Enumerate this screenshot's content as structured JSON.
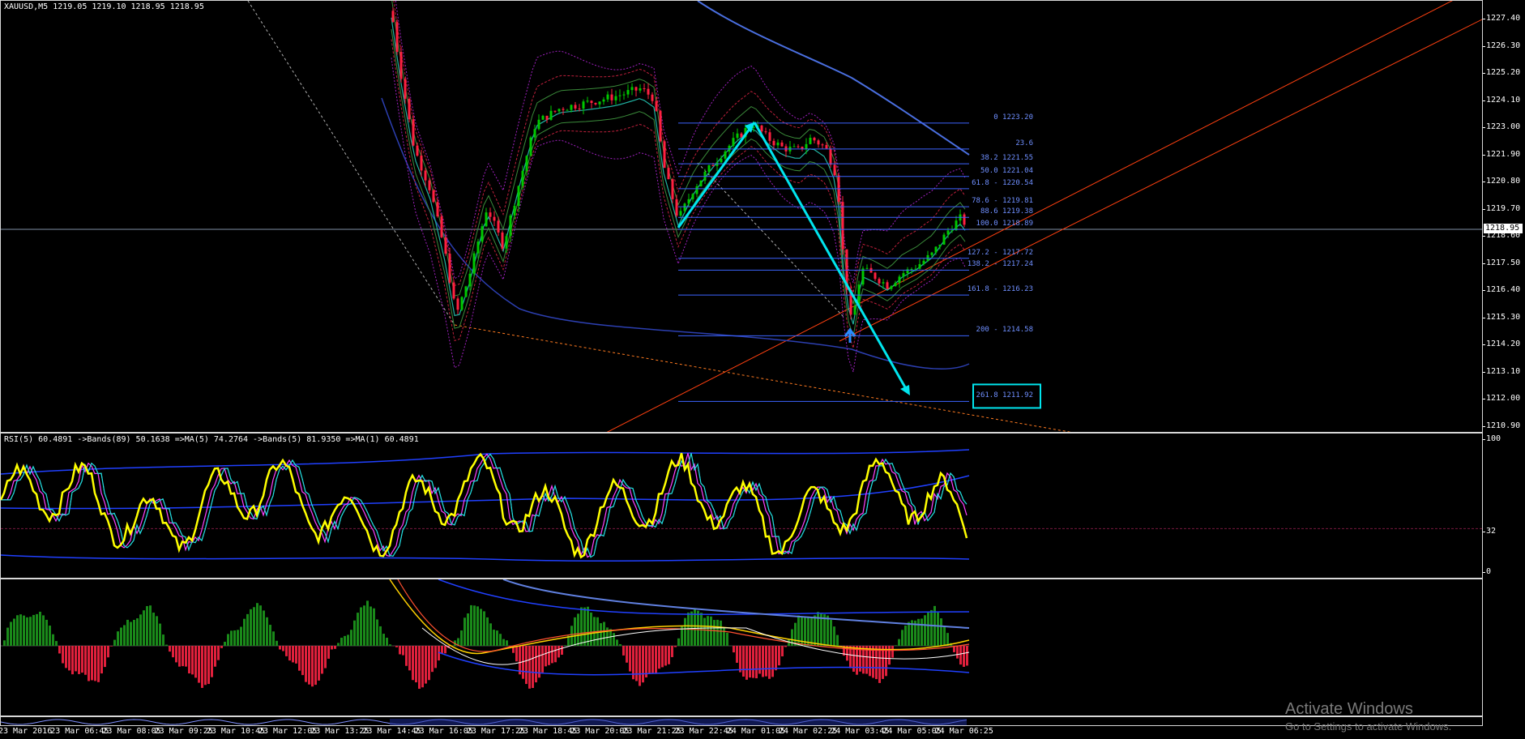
{
  "window": {
    "main_title": "XAUUSD,M5  1219.05 1219.10 1218.95 1218.95",
    "rsi_title": "RSI(5) 60.4891  ->Bands(89) 50.1638  =>MA(5) 74.2764  ->Bands(5) 81.9350  =>MA(1) 60.4891",
    "current_price": "1218.95"
  },
  "price_axis": [
    "1227.40",
    "1226.30",
    "1225.20",
    "1224.10",
    "1223.00",
    "1221.90",
    "1220.80",
    "1219.70",
    "1218.60",
    "1217.50",
    "1216.40",
    "1215.30",
    "1214.20",
    "1213.10",
    "1212.00",
    "1210.90"
  ],
  "rsi_axis": [
    "100",
    "32",
    "0"
  ],
  "fib_levels": [
    {
      "label": "0 1223.20",
      "price": 1223.2
    },
    {
      "label": "23.6",
      "price": 1222.15
    },
    {
      "label": "38.2 1221.55",
      "price": 1221.55
    },
    {
      "label": "50.0 1221.04",
      "price": 1221.04
    },
    {
      "label": "61.8 - 1220.54",
      "price": 1220.54
    },
    {
      "label": "78.6 - 1219.81",
      "price": 1219.81
    },
    {
      "label": "88.6 1219.38",
      "price": 1219.38
    },
    {
      "label": "100.0 1218.89",
      "price": 1218.89
    },
    {
      "label": "127.2 - 1217.72",
      "price": 1217.72
    },
    {
      "label": "138.2 - 1217.24",
      "price": 1217.24
    },
    {
      "label": "161.8 - 1216.23",
      "price": 1216.23
    },
    {
      "label": "200 - 1214.58",
      "price": 1214.58
    },
    {
      "label": "261.8 1211.92",
      "price": 1211.92
    }
  ],
  "time_axis": [
    "23 Mar 2016",
    "23 Mar 06:45",
    "23 Mar 08:05",
    "23 Mar 09:25",
    "23 Mar 10:45",
    "23 Mar 12:05",
    "23 Mar 13:25",
    "23 Mar 14:45",
    "23 Mar 16:05",
    "23 Mar 17:25",
    "23 Mar 18:45",
    "23 Mar 20:05",
    "23 Mar 21:25",
    "23 Mar 22:45",
    "24 Mar 01:05",
    "24 Mar 02:25",
    "24 Mar 03:45",
    "24 Mar 05:05",
    "24 Mar 06:25"
  ],
  "watermark": {
    "line1": "Activate Windows",
    "line2": "Go to Settings to activate Windows."
  },
  "colors": {
    "bull": "#00c800",
    "bear": "#ff2040",
    "fib": "#3c64ff",
    "cyan": "#00e5ee",
    "trend": "#ff4010",
    "rsi": "#ffff00",
    "hist_up": "#1a8a1a",
    "hist_dn": "#e0203c"
  }
}
